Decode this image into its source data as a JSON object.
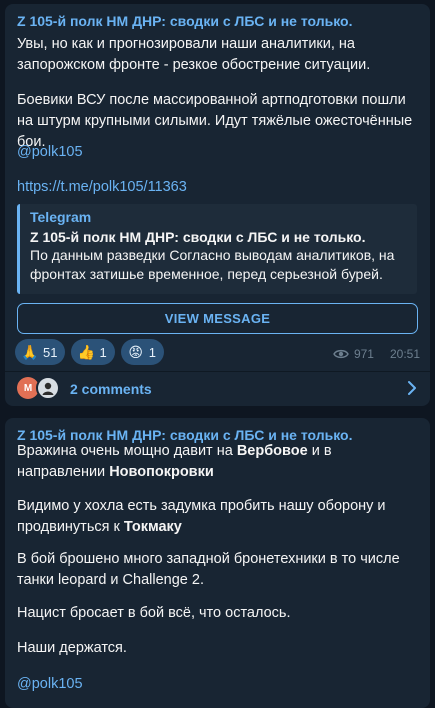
{
  "post1": {
    "channel": "Z 105-й полк НМ ДНР: сводки с ЛБС и не только.",
    "p1": "Увы, но как и прогнозировали наши аналитики, на запорожском фронте - резкое обострение ситуации.",
    "p2": "Боевики ВСУ после массированной артподготовки пошли на штурм крупными силыми. Идут тяжёлые ожесточённые бои.",
    "mention": "@polk105",
    "link": "https://t.me/polk105/11363",
    "quote": {
      "source": "Telegram",
      "title": "Z 105-й полк НМ ДНР: сводки с ЛБС и не только.",
      "text": "По данным разведки Согласно выводам аналитиков, на фронтах затишье временное, перед серьезной бурей.",
      "ellipsis": "..."
    },
    "view_button": "VIEW MESSAGE",
    "reactions": [
      {
        "emoji": "🙏",
        "icon": "praying-hands-icon",
        "count": "51"
      },
      {
        "emoji": "👍",
        "icon": "thumbs-up-icon",
        "count": "1"
      },
      {
        "emoji": "😡",
        "icon": "angry-face-icon",
        "count": "1"
      }
    ],
    "views": "971",
    "time": "20:51",
    "avatar_letter": "M",
    "comments": "2 comments"
  },
  "post2": {
    "channel": "Z 105-й полк НМ ДНР: сводки с ЛБС и не только.",
    "l1a": "Вражина очень мощно давит на ",
    "l1b": "Вербовое",
    "l1c": " и в направлении ",
    "l1d": "Новопокровки",
    "l2a": "Видимо у хохла есть задумка пробить нашу оборону и продвинуться к ",
    "l2b": "Токмаку",
    "l3": "В бой брошено много западной бронетехники в то числе танки leopard и Challenge 2.",
    "l4": "Нацист бросает в бой всё, что осталось.",
    "l5": "Наши держатся.",
    "mention": "@polk105"
  },
  "colors": {
    "background": "#0e1621",
    "bubble": "#182533",
    "accent": "#6ab3f3",
    "reaction_bg": "#2b5278",
    "meta": "#6d7f8f"
  }
}
